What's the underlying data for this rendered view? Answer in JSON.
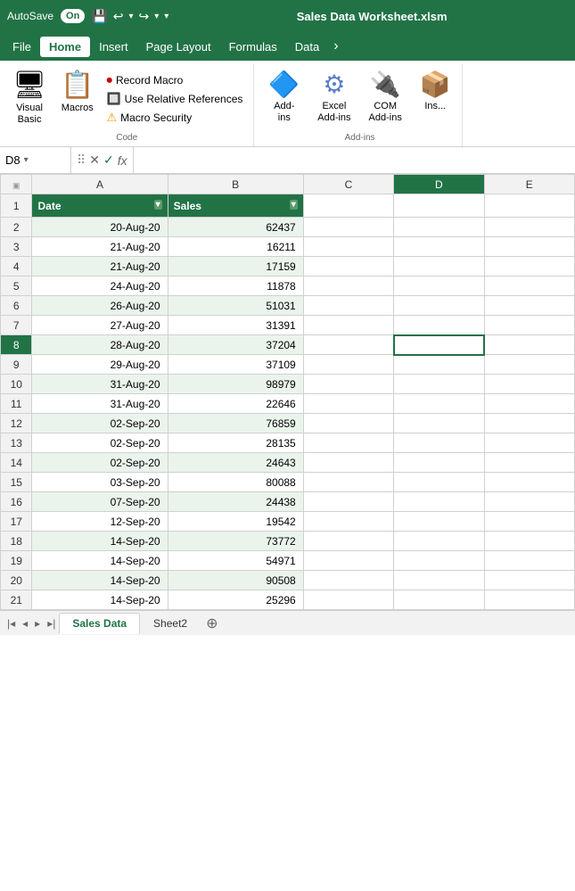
{
  "titleBar": {
    "autosave": "AutoSave",
    "toggleState": "On",
    "filename": "Sales Data Worksheet.xlsm",
    "undoIcon": "↩",
    "redoIcon": "↪"
  },
  "menuBar": {
    "items": [
      "File",
      "Home",
      "Insert",
      "Page Layout",
      "Formulas",
      "Data"
    ]
  },
  "ribbon": {
    "code": {
      "visualBasicLabel": "Visual\nBasic",
      "macrosLabel": "Macros",
      "recordMacroLabel": "Record Macro",
      "relativeRefsLabel": "Use Relative References",
      "macroSecurityLabel": "Macro Security",
      "sectionLabel": "Code"
    },
    "addins": {
      "addinsLabel": "Add-ins",
      "excelAddinsLabel": "Excel\nAdd-ins",
      "comAddinsLabel": "COM\nAdd-ins",
      "insertLabel": "Ins...",
      "sectionLabel": "Add-ins"
    }
  },
  "formulaBar": {
    "cellRef": "D8",
    "cancelIcon": "✕",
    "confirmIcon": "✓",
    "formulaIcon": "fx",
    "value": ""
  },
  "spreadsheet": {
    "columns": [
      "",
      "A",
      "B",
      "C",
      "D",
      "E"
    ],
    "headerRow": {
      "date": "Date",
      "sales": "Sales"
    },
    "rows": [
      {
        "num": 1,
        "isHeader": true
      },
      {
        "num": 2,
        "a": "20-Aug-20",
        "b": "62437"
      },
      {
        "num": 3,
        "a": "21-Aug-20",
        "b": "16211"
      },
      {
        "num": 4,
        "a": "21-Aug-20",
        "b": "17159"
      },
      {
        "num": 5,
        "a": "24-Aug-20",
        "b": "11878"
      },
      {
        "num": 6,
        "a": "26-Aug-20",
        "b": "51031"
      },
      {
        "num": 7,
        "a": "27-Aug-20",
        "b": "31391"
      },
      {
        "num": 8,
        "a": "28-Aug-20",
        "b": "37204",
        "isSelected": true
      },
      {
        "num": 9,
        "a": "29-Aug-20",
        "b": "37109"
      },
      {
        "num": 10,
        "a": "31-Aug-20",
        "b": "98979"
      },
      {
        "num": 11,
        "a": "31-Aug-20",
        "b": "22646"
      },
      {
        "num": 12,
        "a": "02-Sep-20",
        "b": "76859"
      },
      {
        "num": 13,
        "a": "02-Sep-20",
        "b": "28135"
      },
      {
        "num": 14,
        "a": "02-Sep-20",
        "b": "24643"
      },
      {
        "num": 15,
        "a": "03-Sep-20",
        "b": "80088"
      },
      {
        "num": 16,
        "a": "07-Sep-20",
        "b": "24438"
      },
      {
        "num": 17,
        "a": "12-Sep-20",
        "b": "19542"
      },
      {
        "num": 18,
        "a": "14-Sep-20",
        "b": "73772"
      },
      {
        "num": 19,
        "a": "14-Sep-20",
        "b": "54971"
      },
      {
        "num": 20,
        "a": "14-Sep-20",
        "b": "90508"
      },
      {
        "num": 21,
        "a": "14-Sep-20",
        "b": "25296"
      }
    ]
  },
  "sheets": {
    "tabs": [
      "Sales Data",
      "Sheet2"
    ],
    "activeTab": "Sales Data"
  }
}
